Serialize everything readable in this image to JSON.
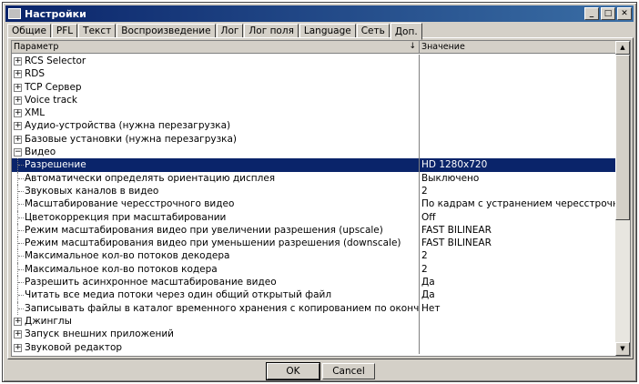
{
  "window": {
    "title": "Настройки"
  },
  "title_buttons": {
    "minimize": "_",
    "maximize": "□",
    "close": "✕"
  },
  "tabs": [
    {
      "label": "Общие"
    },
    {
      "label": "PFL"
    },
    {
      "label": "Текст"
    },
    {
      "label": "Воспроизведение"
    },
    {
      "label": "Лог"
    },
    {
      "label": "Лог поля"
    },
    {
      "label": "Language"
    },
    {
      "label": "Сеть"
    },
    {
      "label": "Доп.",
      "active": true
    }
  ],
  "grid": {
    "header": {
      "param": "Параметр",
      "value": "Значение",
      "sort_icon": "↓"
    },
    "rows": [
      {
        "kind": "group",
        "expander": "+",
        "label": "RCS Selector",
        "value": ""
      },
      {
        "kind": "group",
        "expander": "+",
        "label": "RDS",
        "value": ""
      },
      {
        "kind": "group",
        "expander": "+",
        "label": "TCP Сервер",
        "value": ""
      },
      {
        "kind": "group",
        "expander": "+",
        "label": "Voice track",
        "value": ""
      },
      {
        "kind": "group",
        "expander": "+",
        "label": "XML",
        "value": ""
      },
      {
        "kind": "group",
        "expander": "+",
        "label": "Аудио-устройства (нужна перезагрузка)",
        "value": ""
      },
      {
        "kind": "group",
        "expander": "+",
        "label": "Базовые установки (нужна перезагрузка)",
        "value": ""
      },
      {
        "kind": "group",
        "expander": "−",
        "label": "Видео",
        "value": ""
      },
      {
        "kind": "child",
        "label": "Разрешение",
        "value": "HD 1280x720",
        "selected": true
      },
      {
        "kind": "child",
        "label": "Автоматически определять ориентацию дисплея",
        "value": "Выключено"
      },
      {
        "kind": "child",
        "label": "Звуковых каналов в видео",
        "value": "2"
      },
      {
        "kind": "child",
        "label": "Масштабирование чересстрочного видео",
        "value": "По кадрам с устранением чересстрочности"
      },
      {
        "kind": "child",
        "label": "Цветокоррекция при масштабировании",
        "value": "Off"
      },
      {
        "kind": "child",
        "label": "Режим масштабирования видео при увеличении разрешения (upscale)",
        "value": "FAST BILINEAR"
      },
      {
        "kind": "child",
        "label": "Режим масштабирования видео при уменьшении разрешения (downscale)",
        "value": "FAST BILINEAR"
      },
      {
        "kind": "child",
        "label": "Максимальное кол-во потоков декодера",
        "value": "2"
      },
      {
        "kind": "child",
        "label": "Максимальное кол-во потоков кодера",
        "value": "2"
      },
      {
        "kind": "child",
        "label": "Разрешить асинхронное масштабирование видео",
        "value": "Да"
      },
      {
        "kind": "child",
        "label": "Читать все медиа потоки через один общий открытый файл",
        "value": "Да"
      },
      {
        "kind": "child",
        "label": "Записывать файлы в каталог временного хранения с копированием по окончании записи.",
        "value": "Нет"
      },
      {
        "kind": "group",
        "expander": "+",
        "label": "Джинглы",
        "value": ""
      },
      {
        "kind": "group",
        "expander": "+",
        "label": "Запуск внешних приложений",
        "value": ""
      },
      {
        "kind": "group",
        "expander": "+",
        "label": "Звуковой редактор",
        "value": ""
      }
    ]
  },
  "scrollbar": {
    "up_icon": "▲",
    "down_icon": "▼"
  },
  "buttons": {
    "ok": "OK",
    "cancel": "Cancel"
  },
  "colors": {
    "selection": "#0a246a",
    "title_start": "#0a246a",
    "title_end": "#3a6ea5"
  }
}
